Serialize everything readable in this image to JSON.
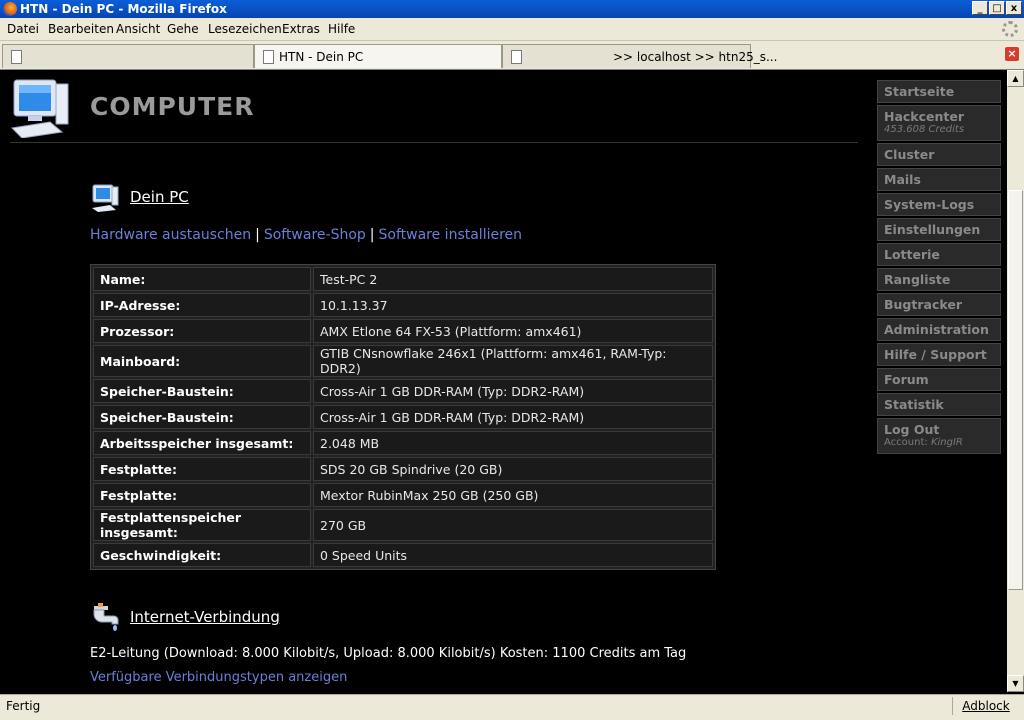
{
  "window": {
    "title": "HTN - Dein PC - Mozilla Firefox",
    "buttons": {
      "minimize": "_",
      "maximize": "□",
      "close": "x"
    }
  },
  "menu": [
    {
      "label": "Datei"
    },
    {
      "label": "Bearbeiten"
    },
    {
      "label": "Ansicht"
    },
    {
      "label": "Gehe"
    },
    {
      "label": "Lesezeichen"
    },
    {
      "label": "Extras"
    },
    {
      "label": "Hilfe"
    }
  ],
  "tabs": [
    {
      "label": ""
    },
    {
      "label": "HTN - Dein PC"
    },
    {
      "label": ">> localhost >> htn25_s..."
    }
  ],
  "page": {
    "title": "COMPUTER",
    "pc_section": {
      "title": "Dein PC",
      "links": [
        "Hardware austauschen",
        "Software-Shop",
        "Software installieren"
      ],
      "separator": "|"
    },
    "specs": [
      {
        "key": "Name:",
        "value": "Test-PC 2"
      },
      {
        "key": "IP-Adresse:",
        "value": "10.1.13.37"
      },
      {
        "key": "Prozessor:",
        "value": "AMX Etlone 64 FX-53 (Plattform: amx461)"
      },
      {
        "key": "Mainboard:",
        "value": "GTIB CNsnowflake 246x1 (Plattform: amx461, RAM-Typ: DDR2)"
      },
      {
        "key": "Speicher-Baustein:",
        "value": "Cross-Air 1 GB DDR-RAM (Typ: DDR2-RAM)"
      },
      {
        "key": "Speicher-Baustein:",
        "value": "Cross-Air 1 GB DDR-RAM (Typ: DDR2-RAM)"
      },
      {
        "key": "Arbeitsspeicher insgesamt:",
        "value": "2.048 MB"
      },
      {
        "key": "Festplatte:",
        "value": "SDS 20 GB Spindrive (20 GB)"
      },
      {
        "key": "Festplatte:",
        "value": "Mextor RubinMax 250 GB (250 GB)"
      },
      {
        "key": "Festplattenspeicher insgesamt:",
        "value": "270 GB"
      },
      {
        "key": "Geschwindigkeit:",
        "value": "0 Speed Units"
      }
    ],
    "inet_section": {
      "title": "Internet-Verbindung",
      "text": "E2-Leitung (Download: 8.000 Kilobit/s, Upload: 8.000 Kilobit/s) Kosten: 1100 Credits am Tag",
      "link": "Verfügbare Verbindungstypen anzeigen"
    }
  },
  "nav": [
    {
      "label": "Startseite"
    },
    {
      "label": "Hackcenter",
      "sub": "453.608 Credits"
    },
    {
      "label": "Cluster"
    },
    {
      "label": "Mails"
    },
    {
      "label": "System-Logs"
    },
    {
      "label": "Einstellungen"
    },
    {
      "label": "Lotterie"
    },
    {
      "label": "Rangliste"
    },
    {
      "label": "Bugtracker"
    },
    {
      "label": "Administration"
    },
    {
      "label": "Hilfe / Support"
    },
    {
      "label": "Forum"
    },
    {
      "label": "Statistik"
    },
    {
      "label": "Log Out",
      "sub_prefix": "Account: ",
      "sub_name": "KingIR"
    }
  ],
  "status": {
    "text": "Fertig",
    "adblock": "Adblock"
  }
}
